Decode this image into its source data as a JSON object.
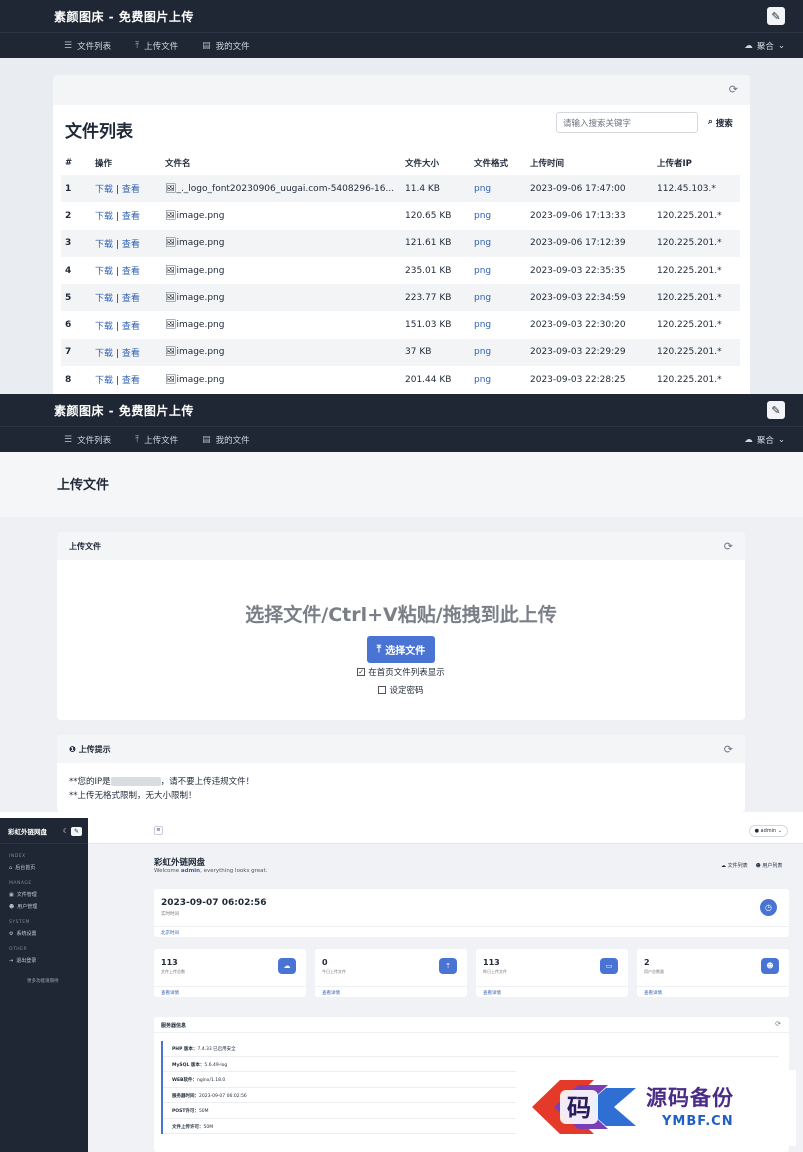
{
  "nav": {
    "brand": "素颜图床 - 免费图片上传",
    "links": [
      "文件列表",
      "上传文件",
      "我的文件"
    ],
    "user": "聚合"
  },
  "list_page": {
    "title": "文件列表",
    "search_placeholder": "请输入搜索关键字",
    "search_button": "搜索",
    "columns": [
      "#",
      "操作",
      "文件名",
      "文件大小",
      "文件格式",
      "上传时间",
      "上传者IP"
    ],
    "action_download": "下载",
    "action_sep": "|",
    "action_view": "查看",
    "rows": [
      {
        "no": "1",
        "name": "_._logo_font20230906_uugai.com-5408296-16...",
        "size": "11.4 KB",
        "format": "png",
        "time": "2023-09-06 17:47:00",
        "ip": "112.45.103.*"
      },
      {
        "no": "2",
        "name": "image.png",
        "size": "120.65 KB",
        "format": "png",
        "time": "2023-09-06 17:13:33",
        "ip": "120.225.201.*"
      },
      {
        "no": "3",
        "name": "image.png",
        "size": "121.61 KB",
        "format": "png",
        "time": "2023-09-06 17:12:39",
        "ip": "120.225.201.*"
      },
      {
        "no": "4",
        "name": "image.png",
        "size": "235.01 KB",
        "format": "png",
        "time": "2023-09-03 22:35:35",
        "ip": "120.225.201.*"
      },
      {
        "no": "5",
        "name": "image.png",
        "size": "223.77 KB",
        "format": "png",
        "time": "2023-09-03 22:34:59",
        "ip": "120.225.201.*"
      },
      {
        "no": "6",
        "name": "image.png",
        "size": "151.03 KB",
        "format": "png",
        "time": "2023-09-03 22:30:20",
        "ip": "120.225.201.*"
      },
      {
        "no": "7",
        "name": "image.png",
        "size": "37 KB",
        "format": "png",
        "time": "2023-09-03 22:29:29",
        "ip": "120.225.201.*"
      },
      {
        "no": "8",
        "name": "image.png",
        "size": "201.44 KB",
        "format": "png",
        "time": "2023-09-03 22:28:25",
        "ip": "120.225.201.*"
      }
    ]
  },
  "upload_page": {
    "title": "上传文件",
    "card_title": "上传文件",
    "drop_text": "选择文件/Ctrl+V粘贴/拖拽到此上传",
    "choose_button": "选择文件",
    "show_on_home": "在首页文件列表显示",
    "set_password": "设定密码",
    "tips_title": "上传提示",
    "tip1_prefix": "**您的IP是",
    "tip1_suffix": "，请不要上传违规文件！",
    "tip2": "**上传无格式限制，无大小限制！"
  },
  "admin": {
    "site": "彩虹外链网盘",
    "groups": {
      "index": "INDEX",
      "manage": "MANAGE",
      "system": "SYSTEM",
      "other": "OTHER"
    },
    "menu": {
      "home": "后台首页",
      "files": "文件管理",
      "users": "用户管理",
      "settings": "系统设置",
      "logout": "退出登录"
    },
    "more": "更多功能请期待",
    "user_chip": "admin",
    "dash_title": "彩虹外链网盘",
    "welcome_prefix": "Welcome",
    "welcome_user": "admin",
    "welcome_suffix": ", everything looks great.",
    "top_files": "文件列表",
    "top_users": "用户列表",
    "clock": "2023-09-07 06:02:56",
    "clock_label": "实时时间",
    "clock_foot": "北京时间",
    "stats": [
      {
        "value": "113",
        "label": "文件上传总数",
        "foot": "查看详情",
        "icon": "cloud-icon"
      },
      {
        "value": "0",
        "label": "今日上传文件",
        "foot": "查看详情",
        "icon": "cloud-upload-icon"
      },
      {
        "value": "113",
        "label": "昨日上传文件",
        "foot": "查看详情",
        "icon": "inbox-icon"
      },
      {
        "value": "2",
        "label": "用户总数量",
        "foot": "查看详情",
        "icon": "users-icon"
      }
    ],
    "server_title": "服务器信息",
    "server": [
      {
        "k": "PHP 版本：",
        "v": "7.4.33 已启用安全"
      },
      {
        "k": "MySQL 版本：",
        "v": "5.6.49-log"
      },
      {
        "k": "WEB软件：",
        "v": "nginx/1.18.0"
      },
      {
        "k": "服务器时间：",
        "v": "2023-09-07 06:02:56"
      },
      {
        "k": "POST许可：",
        "v": "50M"
      },
      {
        "k": "文件上传许可：",
        "v": "50M"
      }
    ]
  },
  "watermark": {
    "char": "码",
    "title": "源码备份",
    "domain": "YMBF.CN"
  }
}
